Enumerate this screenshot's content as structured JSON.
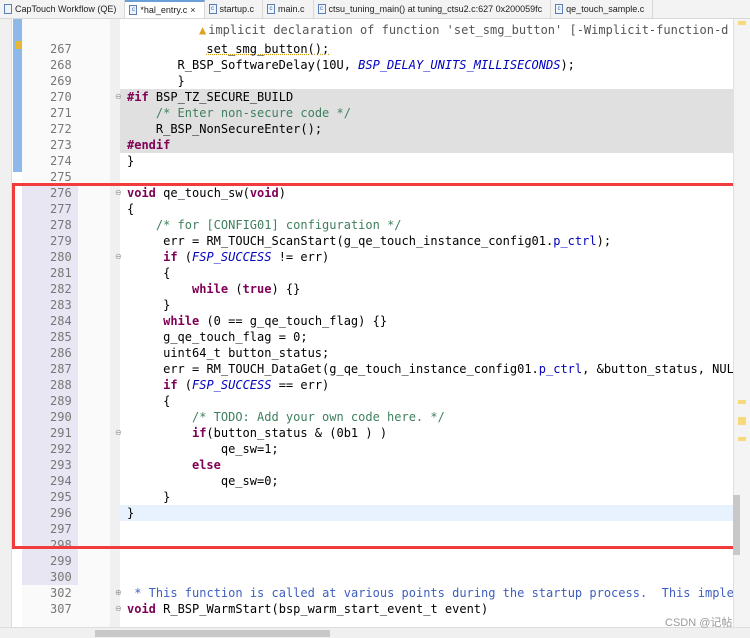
{
  "tabs": [
    {
      "label": "CapTouch Workflow (QE)",
      "active": false
    },
    {
      "label": "*hal_entry.c",
      "active": true,
      "closable": true
    },
    {
      "label": "startup.c",
      "active": false
    },
    {
      "label": "main.c",
      "active": false
    },
    {
      "label": "ctsu_tuning_main() at tuning_ctsu2.c:627 0x200059fc",
      "active": false
    },
    {
      "label": "qe_touch_sample.c",
      "active": false
    }
  ],
  "editor": {
    "warning_annotation": "implicit declaration of function 'set_smg_button' [-Wimplicit-function-d",
    "lines": [
      {
        "n": "267",
        "text": "set_smg_button();",
        "indent": 11,
        "warn": true
      },
      {
        "n": "268",
        "text": "R_BSP_SoftwareDelay(10U, BSP_DELAY_UNITS_MILLISECONDS);",
        "indent": 7
      },
      {
        "n": "269",
        "text": "}",
        "indent": 7
      },
      {
        "n": "270",
        "text": "#if BSP_TZ_SECURE_BUILD",
        "indent": 0,
        "grey": true
      },
      {
        "n": "271",
        "text": "/* Enter non-secure code */",
        "indent": 4,
        "grey": true
      },
      {
        "n": "272",
        "text": "R_BSP_NonSecureEnter();",
        "indent": 4,
        "grey": true
      },
      {
        "n": "273",
        "text": "#endif",
        "indent": 0,
        "grey": true
      },
      {
        "n": "274",
        "text": "}",
        "indent": 0
      },
      {
        "n": "275",
        "text": "",
        "indent": 0
      },
      {
        "n": "276",
        "text": "void qe_touch_sw(void)",
        "indent": 0,
        "mod": true
      },
      {
        "n": "277",
        "text": "{",
        "indent": 0,
        "mod": true
      },
      {
        "n": "278",
        "text": "/* for [CONFIG01] configuration */",
        "indent": 4,
        "mod": true
      },
      {
        "n": "279",
        "text": "err = RM_TOUCH_ScanStart(g_qe_touch_instance_config01.p_ctrl);",
        "indent": 5,
        "mod": true
      },
      {
        "n": "280",
        "text": "if (FSP_SUCCESS != err)",
        "indent": 5,
        "mod": true
      },
      {
        "n": "281",
        "text": "{",
        "indent": 5,
        "mod": true
      },
      {
        "n": "282",
        "text": "while (true) {}",
        "indent": 9,
        "mod": true
      },
      {
        "n": "283",
        "text": "}",
        "indent": 5,
        "mod": true
      },
      {
        "n": "284",
        "text": "while (0 == g_qe_touch_flag) {}",
        "indent": 5,
        "mod": true
      },
      {
        "n": "285",
        "text": "g_qe_touch_flag = 0;",
        "indent": 5,
        "mod": true
      },
      {
        "n": "286",
        "text": "uint64_t button_status;",
        "indent": 5,
        "mod": true
      },
      {
        "n": "287",
        "text": "err = RM_TOUCH_DataGet(g_qe_touch_instance_config01.p_ctrl, &button_status, NUL",
        "indent": 5,
        "mod": true
      },
      {
        "n": "288",
        "text": "if (FSP_SUCCESS == err)",
        "indent": 5,
        "mod": true
      },
      {
        "n": "289",
        "text": "{",
        "indent": 5,
        "mod": true
      },
      {
        "n": "290",
        "text": "/* TODO: Add your own code here. */",
        "indent": 9,
        "mod": true
      },
      {
        "n": "291",
        "text": "if(button_status & (0b1 ) )",
        "indent": 9,
        "mod": true
      },
      {
        "n": "292",
        "text": "qe_sw=1;",
        "indent": 13,
        "mod": true
      },
      {
        "n": "293",
        "text": "else",
        "indent": 9,
        "mod": true
      },
      {
        "n": "294",
        "text": "qe_sw=0;",
        "indent": 13,
        "mod": true
      },
      {
        "n": "295",
        "text": "}",
        "indent": 5,
        "mod": true
      },
      {
        "n": "296",
        "text": "}",
        "indent": 0,
        "mod": true,
        "current": true
      },
      {
        "n": "297",
        "text": "",
        "indent": 0,
        "mod": true
      },
      {
        "n": "298",
        "text": "",
        "indent": 0,
        "mod": true
      },
      {
        "n": "299",
        "text": "",
        "indent": 0,
        "mod": true
      },
      {
        "n": "300",
        "text": "",
        "indent": 0,
        "mod": true
      },
      {
        "n": "302",
        "text": " * This function is called at various points during the startup process.  This imple",
        "indent": 0,
        "comment": true
      },
      {
        "n": "307",
        "text": "void R_BSP_WarmStart(bsp_warm_start_event_t event)",
        "indent": 0
      }
    ]
  },
  "watermark": "CSDN @记帖",
  "colors": {
    "keyword": "#7f0055",
    "comment": "#3f7f5f",
    "macro": "#0000c0",
    "highlight_box": "#f03c3c"
  }
}
